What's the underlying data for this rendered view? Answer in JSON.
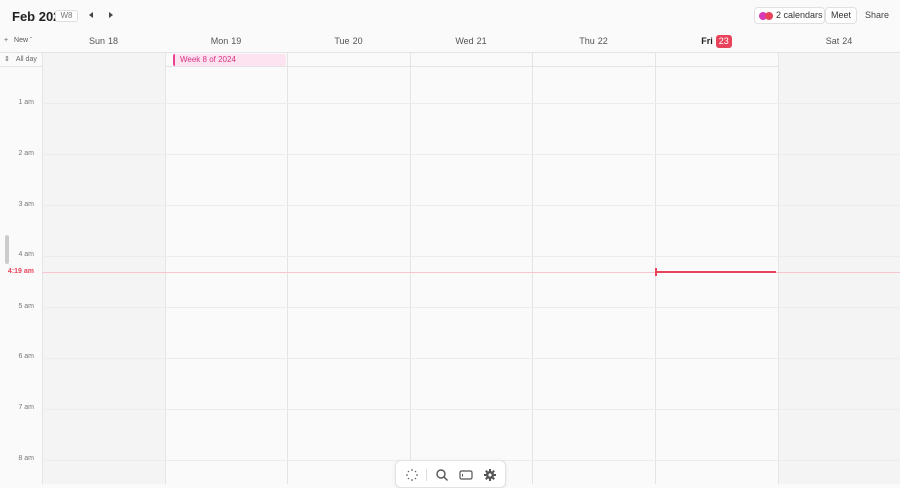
{
  "header": {
    "month": "Feb 2024",
    "week_badge": "W8",
    "prev_icon": "triangle-left-icon",
    "next_icon": "triangle-right-icon",
    "calendars_label": "2 calendars",
    "calendar_colors": [
      "#d63ab8",
      "#e8435a"
    ],
    "meet_label": "Meet",
    "share_label": "Share"
  },
  "dayheader": {
    "new_label": "New",
    "days": [
      {
        "name": "Sun",
        "num": "18"
      },
      {
        "name": "Mon",
        "num": "19"
      },
      {
        "name": "Tue",
        "num": "20"
      },
      {
        "name": "Wed",
        "num": "21"
      },
      {
        "name": "Thu",
        "num": "22"
      },
      {
        "name": "Fri",
        "num": "23",
        "today": true
      },
      {
        "name": "Sat",
        "num": "24"
      }
    ]
  },
  "allday": {
    "label": "All day",
    "event": "Week 8 of 2024",
    "event_color": "#e8438f"
  },
  "timeline": {
    "hours": [
      "1 am",
      "2 am",
      "3 am",
      "4 am",
      "5 am",
      "6 am",
      "7 am",
      "8 am"
    ],
    "now_label": "4:19 am",
    "accent": "#e8435a"
  },
  "dock": {
    "icons": [
      "sparkle-icon",
      "search-icon",
      "keyboard-icon",
      "gear-icon"
    ]
  }
}
